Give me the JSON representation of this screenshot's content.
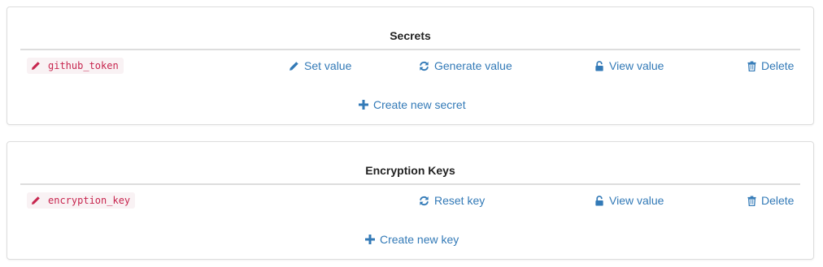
{
  "colors": {
    "link": "#337ab7",
    "code_text": "#c7254e",
    "code_bg": "#f9f2f4",
    "border": "#dddddd"
  },
  "secrets_panel": {
    "title": "Secrets",
    "item": {
      "name": "github_token",
      "icon": "pencil-icon"
    },
    "actions": {
      "set_value": {
        "label": "Set value",
        "icon": "pencil-icon"
      },
      "generate_value": {
        "label": "Generate value",
        "icon": "refresh-icon"
      },
      "view_value": {
        "label": "View value",
        "icon": "unlock-icon"
      },
      "delete": {
        "label": "Delete",
        "icon": "trash-icon"
      }
    },
    "create": {
      "label": "Create new secret",
      "icon": "plus-icon"
    }
  },
  "keys_panel": {
    "title": "Encryption Keys",
    "item": {
      "name": "encryption_key",
      "icon": "pencil-icon"
    },
    "actions": {
      "reset_key": {
        "label": "Reset key",
        "icon": "refresh-icon"
      },
      "view_value": {
        "label": "View value",
        "icon": "unlock-icon"
      },
      "delete": {
        "label": "Delete",
        "icon": "trash-icon"
      }
    },
    "create": {
      "label": "Create new key",
      "icon": "plus-icon"
    }
  }
}
